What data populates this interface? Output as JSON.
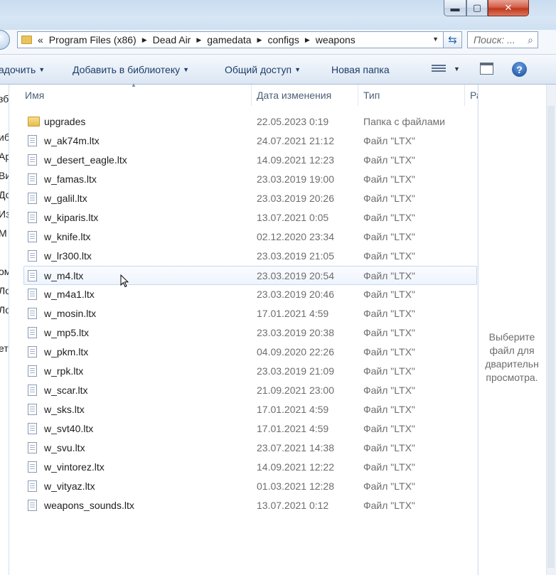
{
  "window": {
    "min_glyph": "▬",
    "max_glyph": "▢",
    "close_glyph": "✕"
  },
  "address": {
    "chevron": "«",
    "crumbs": [
      "Program Files (x86)",
      "Dead Air",
      "gamedata",
      "configs",
      "weapons"
    ],
    "search_placeholder": "Поиск: ..."
  },
  "toolbar": {
    "organize": "адочить",
    "add_library": "Добавить в библиотеку",
    "share": "Общий доступ",
    "new_folder": "Новая папка"
  },
  "navpane": [
    "зб",
    "иб",
    "Ар",
    "Ви",
    "До",
    "Из",
    "М",
    "ом",
    "Ло",
    "Ло",
    "ет"
  ],
  "columns": {
    "name": "Имя",
    "date": "Дата изменения",
    "type": "Тип",
    "size": "Ра"
  },
  "files": [
    {
      "name": "upgrades",
      "date": "22.05.2023 0:19",
      "type": "Папка с файлами",
      "kind": "folder"
    },
    {
      "name": "w_ak74m.ltx",
      "date": "24.07.2021 21:12",
      "type": "Файл \"LTX\"",
      "kind": "file"
    },
    {
      "name": "w_desert_eagle.ltx",
      "date": "14.09.2021 12:23",
      "type": "Файл \"LTX\"",
      "kind": "file"
    },
    {
      "name": "w_famas.ltx",
      "date": "23.03.2019 19:00",
      "type": "Файл \"LTX\"",
      "kind": "file"
    },
    {
      "name": "w_galil.ltx",
      "date": "23.03.2019 20:26",
      "type": "Файл \"LTX\"",
      "kind": "file"
    },
    {
      "name": "w_kiparis.ltx",
      "date": "13.07.2021 0:05",
      "type": "Файл \"LTX\"",
      "kind": "file"
    },
    {
      "name": "w_knife.ltx",
      "date": "02.12.2020 23:34",
      "type": "Файл \"LTX\"",
      "kind": "file"
    },
    {
      "name": "w_lr300.ltx",
      "date": "23.03.2019 21:05",
      "type": "Файл \"LTX\"",
      "kind": "file"
    },
    {
      "name": "w_m4.ltx",
      "date": "23.03.2019 20:54",
      "type": "Файл \"LTX\"",
      "kind": "file",
      "hover": true
    },
    {
      "name": "w_m4a1.ltx",
      "date": "23.03.2019 20:46",
      "type": "Файл \"LTX\"",
      "kind": "file"
    },
    {
      "name": "w_mosin.ltx",
      "date": "17.01.2021 4:59",
      "type": "Файл \"LTX\"",
      "kind": "file"
    },
    {
      "name": "w_mp5.ltx",
      "date": "23.03.2019 20:38",
      "type": "Файл \"LTX\"",
      "kind": "file"
    },
    {
      "name": "w_pkm.ltx",
      "date": "04.09.2020 22:26",
      "type": "Файл \"LTX\"",
      "kind": "file"
    },
    {
      "name": "w_rpk.ltx",
      "date": "23.03.2019 21:09",
      "type": "Файл \"LTX\"",
      "kind": "file"
    },
    {
      "name": "w_scar.ltx",
      "date": "21.09.2021 23:00",
      "type": "Файл \"LTX\"",
      "kind": "file"
    },
    {
      "name": "w_sks.ltx",
      "date": "17.01.2021 4:59",
      "type": "Файл \"LTX\"",
      "kind": "file"
    },
    {
      "name": "w_svt40.ltx",
      "date": "17.01.2021 4:59",
      "type": "Файл \"LTX\"",
      "kind": "file"
    },
    {
      "name": "w_svu.ltx",
      "date": "23.07.2021 14:38",
      "type": "Файл \"LTX\"",
      "kind": "file"
    },
    {
      "name": "w_vintorez.ltx",
      "date": "14.09.2021 12:22",
      "type": "Файл \"LTX\"",
      "kind": "file"
    },
    {
      "name": "w_vityaz.ltx",
      "date": "01.03.2021 12:28",
      "type": "Файл \"LTX\"",
      "kind": "file"
    },
    {
      "name": "weapons_sounds.ltx",
      "date": "13.07.2021 0:12",
      "type": "Файл \"LTX\"",
      "kind": "file"
    }
  ],
  "preview": {
    "lines": [
      "Выберите",
      "файл для",
      "дварительн",
      "просмотра."
    ]
  },
  "colors": {
    "accent": "#1e3d6a",
    "hover_border": "#c5d8f0",
    "secondary_text": "#6d6d6d"
  }
}
